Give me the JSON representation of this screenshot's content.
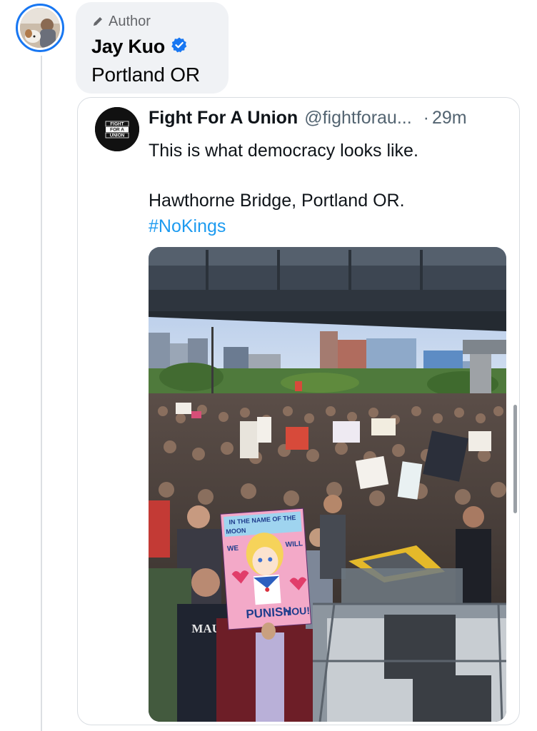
{
  "comment": {
    "badge_label": "Author",
    "badge_icon": "pencil-icon",
    "author_name": "Jay Kuo",
    "verified_icon": "verified-badge-icon",
    "verified_color": "#1877f2",
    "text": "Portland OR"
  },
  "shared_post": {
    "source_name": "Fight For A Union",
    "source_handle": "@fightforau...",
    "dot": "·",
    "time": "29m",
    "logo_text": [
      "FIGHT",
      "FOR A",
      "UNION"
    ],
    "lines": [
      "This is what democracy looks like.",
      "Hawthorne Bridge, Portland OR."
    ],
    "hashtag": "#NoKings",
    "hashtag_color": "#1d9bf0",
    "photo": {
      "description_icon": "protest-photo",
      "sign_text": [
        "IN THE NAME OF THE",
        "MOON",
        "WE",
        "WILL",
        "PUNISH",
        "YOU!"
      ],
      "shirt_text": "MAUI"
    }
  },
  "colors": {
    "accent": "#1877f2",
    "bubble_bg": "#f0f2f5",
    "secondary_text": "#536471"
  }
}
